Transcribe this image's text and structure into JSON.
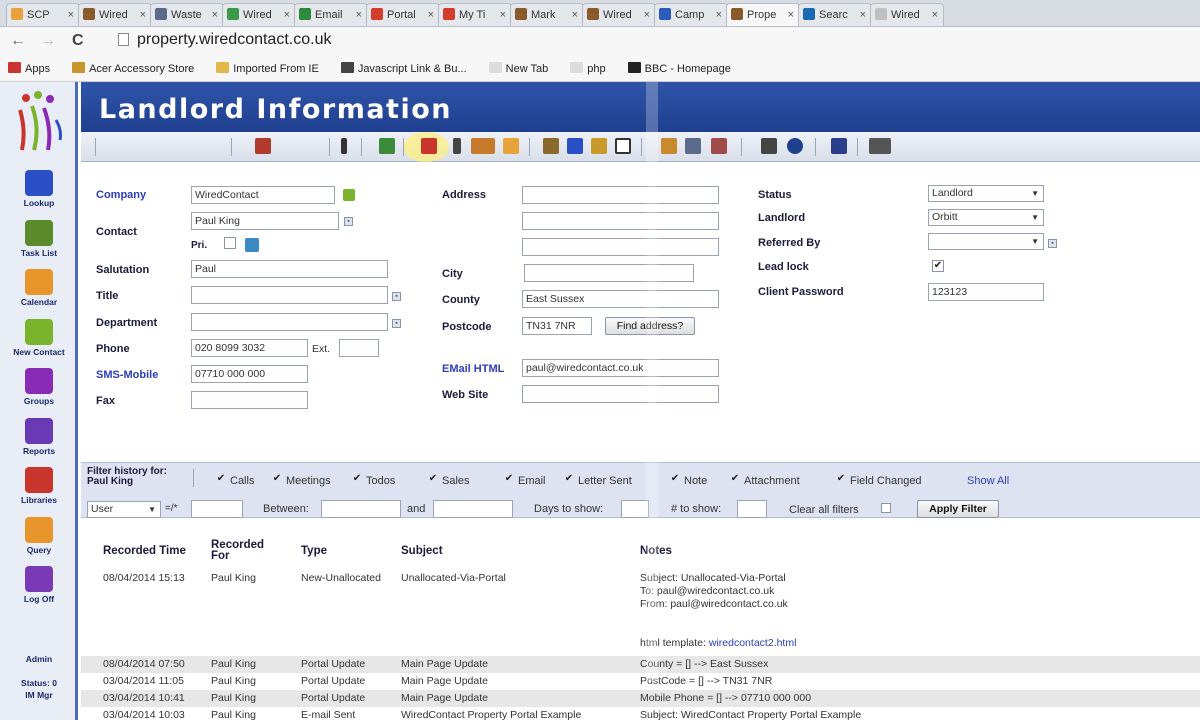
{
  "browser": {
    "tabs": [
      {
        "label": "SCP",
        "color": "#e8a33c"
      },
      {
        "label": "Wired",
        "color": "#8a5a2b"
      },
      {
        "label": "Waste",
        "color": "#5a6a8a"
      },
      {
        "label": "Wired",
        "color": "#3a9a4a"
      },
      {
        "label": "Email",
        "color": "#2c8a3c"
      },
      {
        "label": "Portal",
        "color": "#d43c2c"
      },
      {
        "label": "My Ti",
        "color": "#d43c2c"
      },
      {
        "label": "Mark",
        "color": "#8a5a2b"
      },
      {
        "label": "Wired",
        "color": "#8a5a2b"
      },
      {
        "label": "Camp",
        "color": "#2b5ab8"
      },
      {
        "label": "Prope",
        "color": "#8a5a2b",
        "active": true
      },
      {
        "label": "Searc",
        "color": "#1a6ab5"
      },
      {
        "label": "Wired",
        "color": "#c0c0c0"
      }
    ],
    "close_glyph": "×",
    "back_glyph": "←",
    "forward_glyph": "→",
    "reload_glyph": "C",
    "url": "property.wiredcontact.co.uk",
    "bookmarks": [
      {
        "label": "Apps",
        "color": "#c33"
      },
      {
        "label": "Acer Accessory Store",
        "color": "#c8952c"
      },
      {
        "label": "Imported From IE",
        "color": "#e3b84a"
      },
      {
        "label": "Javascript Link & Bu...",
        "color": "#444"
      },
      {
        "label": "New Tab",
        "color": "#ddd"
      },
      {
        "label": "php",
        "color": "#ddd"
      },
      {
        "label": "BBC - Homepage",
        "color": "#222"
      }
    ]
  },
  "sidebar": {
    "items": [
      {
        "label": "Lookup",
        "color": "#2b4fc4"
      },
      {
        "label": "Task List",
        "color": "#5a8a2b"
      },
      {
        "label": "Calendar",
        "color": "#e8962c"
      },
      {
        "label": "New Contact",
        "color": "#7ab42c"
      },
      {
        "label": "Groups",
        "color": "#8a2bb5"
      },
      {
        "label": "Reports",
        "color": "#6a3ab5"
      },
      {
        "label": "Libraries",
        "color": "#c8352c"
      },
      {
        "label": "Query",
        "color": "#e8962c"
      },
      {
        "label": "Log Off",
        "color": "#7a3ab5"
      }
    ],
    "user": "Admin",
    "status": "Status: 0",
    "role": "IM Mgr"
  },
  "page": {
    "title": "Landlord Information"
  },
  "form": {
    "company_label": "Company",
    "company": "WiredContact",
    "contact_label": "Contact",
    "contact": "Paul King",
    "pri_label": "Pri.",
    "salutation_label": "Salutation",
    "salutation": "Paul",
    "title_label": "Title",
    "title": "",
    "department_label": "Department",
    "department": "",
    "phone_label": "Phone",
    "phone": "020 8099 3032",
    "ext_label": "Ext.",
    "ext": "",
    "sms_label": "SMS-Mobile",
    "sms": "07710 000 000",
    "fax_label": "Fax",
    "fax": "",
    "address_label": "Address",
    "address1": "",
    "address2": "",
    "address3": "",
    "city_label": "City",
    "city": "",
    "county_label": "County",
    "county": "East Sussex",
    "postcode_label": "Postcode",
    "postcode": "TN31 7NR",
    "find_address": "Find address?",
    "email_label": "EMail  HTML",
    "email": "paul@wiredcontact.co.uk",
    "website_label": "Web Site",
    "website": "",
    "status_label": "Status",
    "status": "Landlord",
    "landlord_label": "Landlord",
    "landlord": "Orbitt",
    "referred_label": "Referred By",
    "referred": "",
    "leadlock_label": "Lead lock",
    "password_label": "Client Password",
    "password": "123123",
    "checkmark": "✔",
    "dropdown_glyph": "▼",
    "mini_glyph": "▪"
  },
  "filter": {
    "history_label": "Filter history for:",
    "history_name": "Paul King",
    "calls": "Calls",
    "meetings": "Meetings",
    "todos": "Todos",
    "sales": "Sales",
    "email": "Email",
    "letter": "Letter Sent",
    "note": "Note",
    "attachment": "Attachment",
    "field_changed": "Field Changed",
    "show_all": "Show All",
    "user_select": "User",
    "eq": "=/*",
    "between": "Between:",
    "and": "and",
    "days": "Days to show:",
    "num": "# to show:",
    "clear": "Clear all filters",
    "apply": "Apply Filter"
  },
  "history": {
    "headers": {
      "time": "Recorded Time",
      "for": "Recorded For",
      "type": "Type",
      "subject": "Subject",
      "notes": "Notes"
    },
    "first": {
      "time": "08/04/2014 15:13",
      "for": "Paul King",
      "type": "New-Unallocated",
      "subject": "Unallocated-Via-Portal",
      "n1": "Subject:  Unallocated-Via-Portal",
      "n2": "To: paul@wiredcontact.co.uk",
      "n3": "From: paul@wiredcontact.co.uk",
      "n4a": "html template: ",
      "n4b": "wiredcontact2.html"
    },
    "rows": [
      {
        "time": "08/04/2014 07:50",
        "for": "Paul King",
        "type": "Portal Update",
        "subject": "Main Page Update",
        "notes": "County = [] --> East Sussex"
      },
      {
        "time": "03/04/2014 11:05",
        "for": "Paul King",
        "type": "Portal Update",
        "subject": "Main Page Update",
        "notes": "PostCode = [] --> TN31 7NR"
      },
      {
        "time": "03/04/2014 10:41",
        "for": "Paul King",
        "type": "Portal Update",
        "subject": "Main Page Update",
        "notes": "Mobile Phone = [] --> 07710 000 000"
      },
      {
        "time": "03/04/2014 10:03",
        "for": "Paul King",
        "type": "E-mail Sent",
        "subject": "WiredContact Property Portal Example",
        "notes": "Subject:  WiredContact Property Portal Example"
      }
    ]
  }
}
